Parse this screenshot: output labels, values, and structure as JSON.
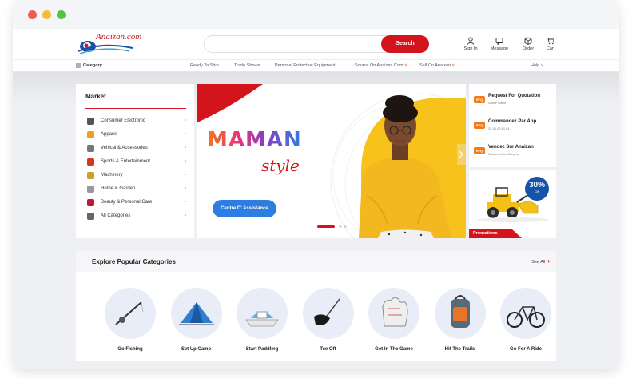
{
  "window": {
    "controls": [
      "close",
      "minimize",
      "maximize"
    ]
  },
  "header": {
    "logo_text": "Anaizan.com",
    "search": {
      "placeholder": "",
      "button_label": "Search"
    },
    "icons": [
      {
        "name": "user-icon",
        "label": "Sign In"
      },
      {
        "name": "message-icon",
        "label": "Message"
      },
      {
        "name": "order-icon",
        "label": "Order"
      },
      {
        "name": "cart-icon",
        "label": "Cart"
      }
    ]
  },
  "nav": {
    "category_label": "Category",
    "links": [
      "Ready To Ship",
      "Trade Shows",
      "Personal Protective Equipment",
      "Source On Anaizan.Com",
      "Sell On Anaizan",
      "Help"
    ]
  },
  "market": {
    "title": "Market",
    "items": [
      {
        "label": "Consumer Electronic",
        "icon": "electronics-icon",
        "color": "#555555"
      },
      {
        "label": "Apparel",
        "icon": "apparel-icon",
        "color": "#e8a21c"
      },
      {
        "label": "Vehical & Accessories",
        "icon": "vehicle-icon",
        "color": "#777777"
      },
      {
        "label": "Sports & Entertainment",
        "icon": "sports-icon",
        "color": "#d4381c"
      },
      {
        "label": "Machinery",
        "icon": "machinery-icon",
        "color": "#c9a12a"
      },
      {
        "label": "Home & Garden",
        "icon": "home-icon",
        "color": "#999999"
      },
      {
        "label": "Beauty & Personal Care",
        "icon": "beauty-icon",
        "color": "#c4182e"
      },
      {
        "label": "All Categories",
        "icon": "grid-icon",
        "color": "#666666"
      }
    ]
  },
  "hero": {
    "headline": "MAMAN",
    "script": "style",
    "button_label": "Centre D' Assistance",
    "slide_index": 1,
    "slide_count": 3
  },
  "rfq": [
    {
      "title": "Request For Quotation",
      "subtitle": "Guide Client",
      "icon": "RFQ"
    },
    {
      "title": "Commandez Par App",
      "subtitle": "25 30 00 81 61",
      "icon": "RFQ"
    },
    {
      "title": "Vendez Sur Anaizan",
      "subtitle": "Ouvrez Votre Shop ici",
      "icon": "RFQ"
    }
  ],
  "promo": {
    "badge_percent": "30%",
    "badge_off": "Off",
    "tag": "Promotions"
  },
  "popular": {
    "title": "Explore Popular Categories",
    "see_all": "See All",
    "categories": [
      {
        "label": "Go Fishing",
        "icon": "fishing-rod-icon"
      },
      {
        "label": "Set Up Camp",
        "icon": "tent-icon"
      },
      {
        "label": "Start Paddling",
        "icon": "paddle-boat-icon"
      },
      {
        "label": "Tee Off",
        "icon": "golf-club-icon"
      },
      {
        "label": "Get In The Game",
        "icon": "baseball-glove-icon"
      },
      {
        "label": "Hit The Trails",
        "icon": "backpack-icon"
      },
      {
        "label": "Go For A Ride",
        "icon": "bicycle-icon"
      }
    ]
  },
  "colors": {
    "accent": "#d4141c",
    "primary_blue": "#2d7ee0",
    "hero_yellow": "#f7c21b",
    "orange": "#f07a1c"
  }
}
